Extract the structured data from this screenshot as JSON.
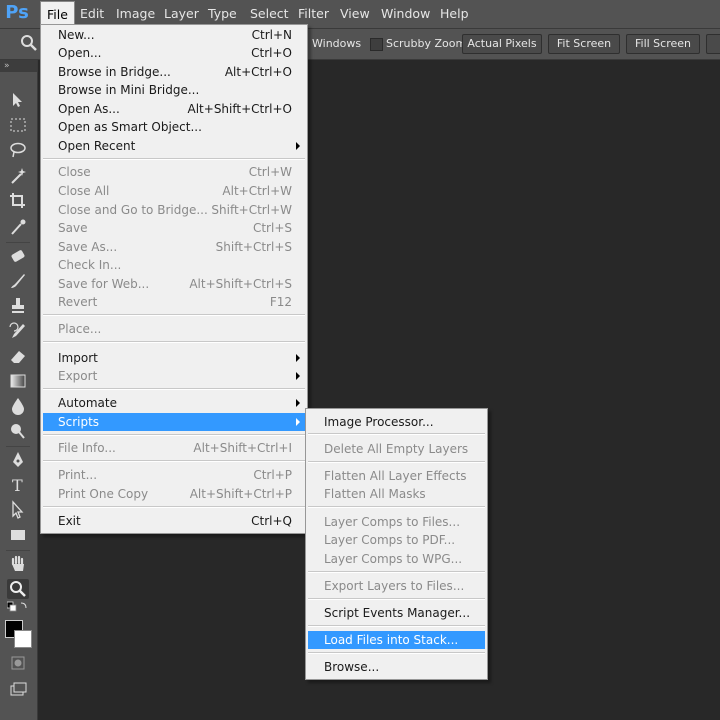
{
  "app": {
    "logo": "Ps"
  },
  "menubar": [
    "File",
    "Edit",
    "Image",
    "Layer",
    "Type",
    "Select",
    "Filter",
    "View",
    "Window",
    "Help"
  ],
  "options": {
    "windows_label": "Windows",
    "scrubby_label": "Scrubby Zoom",
    "buttons": [
      "Actual Pixels",
      "Fit Screen",
      "Fill Screen"
    ]
  },
  "toolbox": {
    "grip": "»"
  },
  "file_menu": [
    {
      "label": "New...",
      "shortcut": "Ctrl+N"
    },
    {
      "label": "Open...",
      "shortcut": "Ctrl+O"
    },
    {
      "label": "Browse in Bridge...",
      "shortcut": "Alt+Ctrl+O"
    },
    {
      "label": "Browse in Mini Bridge...",
      "shortcut": ""
    },
    {
      "label": "Open As...",
      "shortcut": "Alt+Shift+Ctrl+O"
    },
    {
      "label": "Open as Smart Object...",
      "shortcut": ""
    },
    {
      "label": "Open Recent",
      "shortcut": ""
    },
    {
      "label": "Close",
      "shortcut": "Ctrl+W"
    },
    {
      "label": "Close All",
      "shortcut": "Alt+Ctrl+W"
    },
    {
      "label": "Close and Go to Bridge...",
      "shortcut": "Shift+Ctrl+W"
    },
    {
      "label": "Save",
      "shortcut": "Ctrl+S"
    },
    {
      "label": "Save As...",
      "shortcut": "Shift+Ctrl+S"
    },
    {
      "label": "Check In...",
      "shortcut": ""
    },
    {
      "label": "Save for Web...",
      "shortcut": "Alt+Shift+Ctrl+S"
    },
    {
      "label": "Revert",
      "shortcut": "F12"
    },
    {
      "label": "Place...",
      "shortcut": ""
    },
    {
      "label": "Import",
      "shortcut": ""
    },
    {
      "label": "Export",
      "shortcut": ""
    },
    {
      "label": "Automate",
      "shortcut": ""
    },
    {
      "label": "Scripts",
      "shortcut": ""
    },
    {
      "label": "File Info...",
      "shortcut": "Alt+Shift+Ctrl+I"
    },
    {
      "label": "Print...",
      "shortcut": "Ctrl+P"
    },
    {
      "label": "Print One Copy",
      "shortcut": "Alt+Shift+Ctrl+P"
    },
    {
      "label": "Exit",
      "shortcut": "Ctrl+Q"
    }
  ],
  "scripts_menu": [
    "Image Processor...",
    "Delete All Empty Layers",
    "Flatten All Layer Effects",
    "Flatten All Masks",
    "Layer Comps to Files...",
    "Layer Comps to PDF...",
    "Layer Comps to WPG...",
    "Export Layers to Files...",
    "Script Events Manager...",
    "Load Files into Stack...",
    "Browse..."
  ],
  "colors": {
    "highlight": "#3399ff",
    "menu_bg": "#f0f0f0",
    "chrome": "#535353",
    "canvas": "#282828",
    "disabled": "#8a8a8a"
  }
}
